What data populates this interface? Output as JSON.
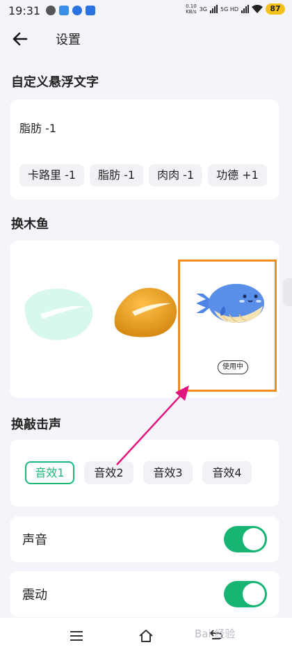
{
  "status_bar": {
    "time": "19:31",
    "net_speed": "0.10",
    "net_unit": "KB/s",
    "sim1": "3G",
    "sim2": "5G HD",
    "battery": "87"
  },
  "header": {
    "title": "设置"
  },
  "custom_text_section": {
    "title": "自定义悬浮文字",
    "current_text": "脂肪 -1",
    "options": [
      "卡路里 -1",
      "脂肪 -1",
      "肉肉 -1",
      "功德 +1"
    ]
  },
  "fish_section": {
    "title": "换木鱼",
    "in_use_label": "使用中"
  },
  "sound_section": {
    "title": "换敲击声",
    "options": [
      "音效1",
      "音效2",
      "音效3",
      "音效4"
    ],
    "selected_index": 0
  },
  "toggles": {
    "sound_label": "声音",
    "sound_on": true,
    "vibrate_label": "震动",
    "vibrate_on": true
  },
  "watermark": "Bai 经验",
  "colors": {
    "accent": "#17b473",
    "highlight": "#f28c1d",
    "annotation_arrow": "#e0147f"
  }
}
